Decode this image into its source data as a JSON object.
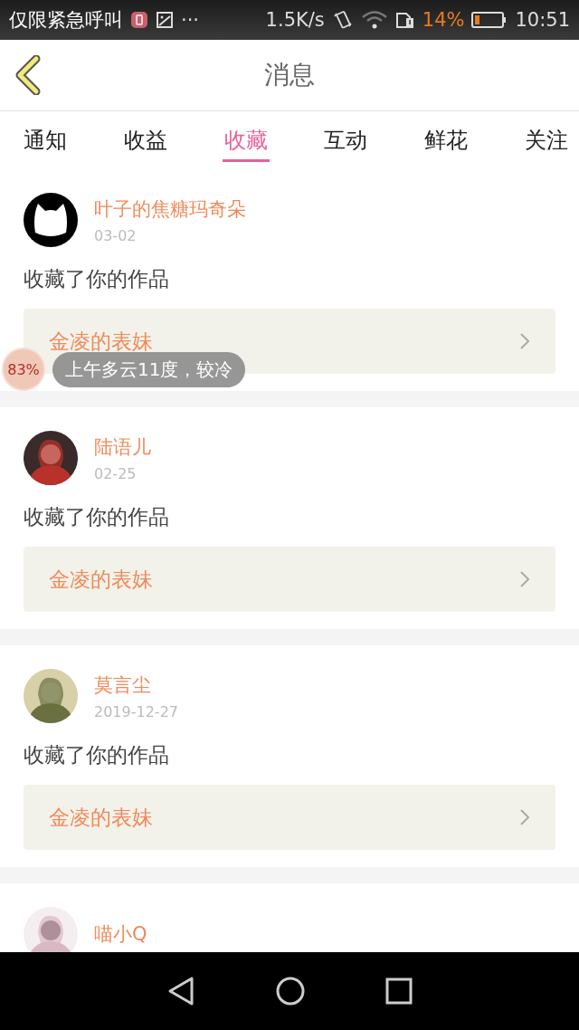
{
  "status_bar": {
    "carrier": "仅限紧急呼叫",
    "more": "···",
    "speed": "1.5K/s",
    "battery": "14%",
    "time": "10:51"
  },
  "header": {
    "title": "消息"
  },
  "tabs": [
    {
      "label": "通知",
      "selected": false
    },
    {
      "label": "收益",
      "selected": false
    },
    {
      "label": "收藏",
      "selected": true
    },
    {
      "label": "互动",
      "selected": false
    },
    {
      "label": "鲜花",
      "selected": false
    },
    {
      "label": "关注",
      "selected": false
    }
  ],
  "messages": [
    {
      "user": "叶子的焦糖玛奇朵",
      "date": "03-02",
      "text": "收藏了你的作品",
      "work": "金凌的表妹"
    },
    {
      "user": "陆语儿",
      "date": "02-25",
      "text": "收藏了你的作品",
      "work": "金凌的表妹"
    },
    {
      "user": "莫言尘",
      "date": "2019-12-27",
      "text": "收藏了你的作品",
      "work": "金凌的表妹"
    },
    {
      "user": "喵小Q"
    }
  ],
  "floating_widget": {
    "percent": "83%",
    "weather": "上午多云11度，较冷"
  }
}
